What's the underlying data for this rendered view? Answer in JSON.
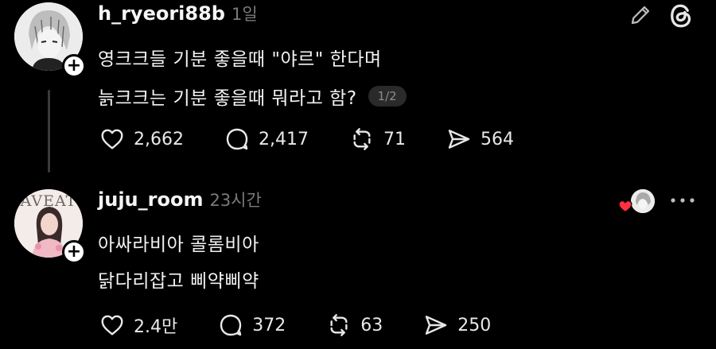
{
  "post1": {
    "username": "h_ryeori88b",
    "time": "1일",
    "lines": [
      "영크크들 기분 좋을때 \"야르\" 한다며",
      "늙크크는 기분 좋을때 뭐라고 함?"
    ],
    "page_indicator": "1/2",
    "likes": "2,662",
    "comments": "2,417",
    "reposts": "71",
    "shares": "564"
  },
  "post2": {
    "username": "juju_room",
    "time": "23시간",
    "lines": [
      "아싸라비아 콜롬비아",
      "닭다리잡고 삐약삐약"
    ],
    "likes": "2.4만",
    "comments": "372",
    "reposts": "63",
    "shares": "250"
  },
  "avatar2_watermark": "AVEAT",
  "icons": {
    "edit": "pencil-icon",
    "app": "threads-logo-icon",
    "like": "heart-icon",
    "comment": "comment-icon",
    "repost": "repost-icon",
    "share": "send-icon",
    "more": "more-icon",
    "liked_by": "red-heart-icon"
  },
  "colors": {
    "background": "#000000",
    "text": "#f3f3f3",
    "muted": "#7a7a7a",
    "heart": "#ff3040"
  }
}
